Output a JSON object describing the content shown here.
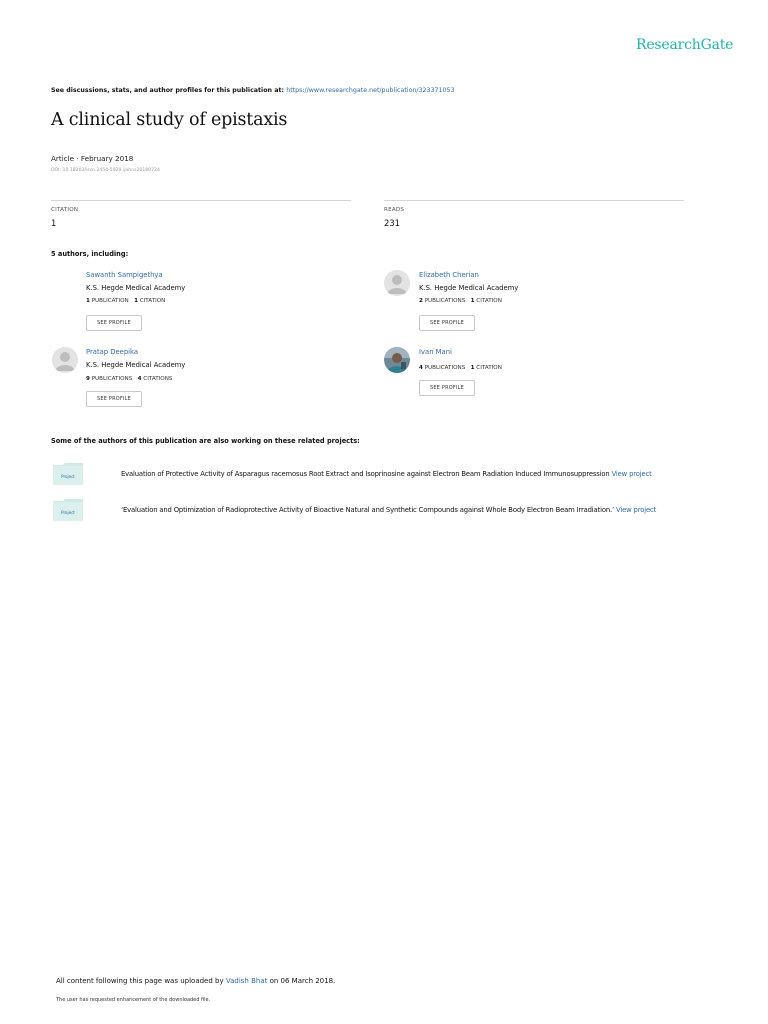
{
  "header": {
    "logo": "ResearchGate",
    "see_discussions_prefix": "See discussions, stats, and author profiles for this publication at: ",
    "publication_url": "https://www.researchgate.net/publication/323371053"
  },
  "article": {
    "title": "A clinical study of epistaxis",
    "type_date": "Article · February 2018",
    "doi": "DOI: 10.18203/issn.2454-5929.ijohns20180724"
  },
  "stats": {
    "citation_label": "CITATION",
    "citation_value": "1",
    "reads_label": "READS",
    "reads_value": "231"
  },
  "authors_heading": "5 authors, including:",
  "authors": [
    {
      "name": "Sawanth Sampigethya",
      "institution": "K.S. Hegde Medical Academy",
      "publications_count": "1",
      "publications_label": "PUBLICATION",
      "citations_count": "1",
      "citations_label": "CITATION",
      "button": "SEE PROFILE",
      "avatar": "no-photo"
    },
    {
      "name": "Elizabeth Cherian",
      "institution": "K.S. Hegde Medical Academy",
      "publications_count": "2",
      "publications_label": "PUBLICATIONS",
      "citations_count": "1",
      "citations_label": "CITATION",
      "button": "SEE PROFILE",
      "avatar": "default-silhouette"
    },
    {
      "name": "Pratap Deepika",
      "institution": "K.S. Hegde Medical Academy",
      "publications_count": "9",
      "publications_label": "PUBLICATIONS",
      "citations_count": "4",
      "citations_label": "CITATIONS",
      "button": "SEE PROFILE",
      "avatar": "default-silhouette"
    },
    {
      "name": "Ivan Mani",
      "institution": "",
      "publications_count": "4",
      "publications_label": "PUBLICATIONS",
      "citations_count": "1",
      "citations_label": "CITATION",
      "button": "SEE PROFILE",
      "avatar": "photo"
    }
  ],
  "projects_heading": "Some of the authors of this publication are also working on these related projects:",
  "projects": [
    {
      "icon_label": "Project",
      "text": "Evaluation of Protective Activity of Asparagus racemosus Root Extract and Isoprinosine against Electron Beam Radiation Induced Immunosuppression ",
      "link": "View project"
    },
    {
      "icon_label": "Project",
      "text": "‘Evaluation and Optimization of Radioprotective Activity of Bioactive Natural and Synthetic Compounds against Whole Body Electron Beam Irradiation.’ ",
      "link": "View project"
    }
  ],
  "footer": {
    "prefix": "All content following this page was uploaded by ",
    "uploader": "Vadish Bhat",
    "suffix": " on 06 March 2018.",
    "note": "The user has requested enhancement of the downloaded file."
  },
  "colors": {
    "brand": "#21b3a6",
    "link": "#2f6aa8",
    "project_icon": "#cfe9e6"
  }
}
